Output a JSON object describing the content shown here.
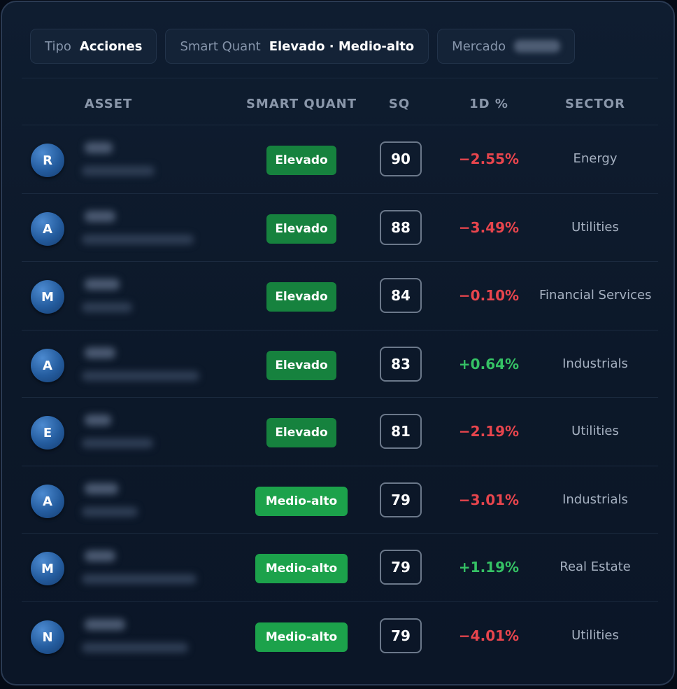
{
  "filters": [
    {
      "label": "Tipo",
      "value": "Acciones"
    },
    {
      "label": "Smart Quant",
      "value": "Elevado · Medio-alto"
    },
    {
      "label": "Mercado",
      "value": ""
    }
  ],
  "table": {
    "headers": {
      "asset": "ASSET",
      "smart_quant": "SMART QUANT",
      "sq": "SQ",
      "change": "1D %",
      "sector": "SECTOR"
    },
    "rows": [
      {
        "initial": "R",
        "rating": "Elevado",
        "rating_level": "elevado",
        "sq": "90",
        "change": "−2.55%",
        "direction": "neg",
        "sector": "Energy"
      },
      {
        "initial": "A",
        "rating": "Elevado",
        "rating_level": "elevado",
        "sq": "88",
        "change": "−3.49%",
        "direction": "neg",
        "sector": "Utilities"
      },
      {
        "initial": "M",
        "rating": "Elevado",
        "rating_level": "elevado",
        "sq": "84",
        "change": "−0.10%",
        "direction": "neg",
        "sector": "Financial Services"
      },
      {
        "initial": "A",
        "rating": "Elevado",
        "rating_level": "elevado",
        "sq": "83",
        "change": "+0.64%",
        "direction": "pos",
        "sector": "Industrials"
      },
      {
        "initial": "E",
        "rating": "Elevado",
        "rating_level": "elevado",
        "sq": "81",
        "change": "−2.19%",
        "direction": "neg",
        "sector": "Utilities"
      },
      {
        "initial": "A",
        "rating": "Medio-alto",
        "rating_level": "medio",
        "sq": "79",
        "change": "−3.01%",
        "direction": "neg",
        "sector": "Industrials"
      },
      {
        "initial": "M",
        "rating": "Medio-alto",
        "rating_level": "medio",
        "sq": "79",
        "change": "+1.19%",
        "direction": "pos",
        "sector": "Real Estate"
      },
      {
        "initial": "N",
        "rating": "Medio-alto",
        "rating_level": "medio",
        "sq": "79",
        "change": "−4.01%",
        "direction": "neg",
        "sector": "Utilities"
      }
    ]
  },
  "colors": {
    "background": "#0c1829",
    "elevado_badge": "#16823e",
    "medio_alto_badge": "#1ca24b",
    "negative": "#e8454d",
    "positive": "#35c265",
    "avatar": "#245c9e"
  }
}
